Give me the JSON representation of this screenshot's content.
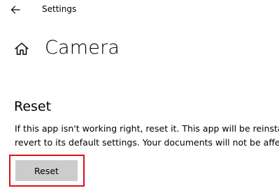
{
  "header": {
    "back_icon": "arrow-left-icon",
    "window_title": "Settings"
  },
  "page": {
    "home_icon": "home-icon",
    "title": "Camera"
  },
  "reset_section": {
    "heading": "Reset",
    "description_lines": [
      "If this app isn't working right, reset it. This app will be reinstal",
      "revert to its default settings. Your documents will not be affec"
    ],
    "button_label": "Reset",
    "highlight_color": "#d8121c",
    "button_color": "#cccccc"
  }
}
